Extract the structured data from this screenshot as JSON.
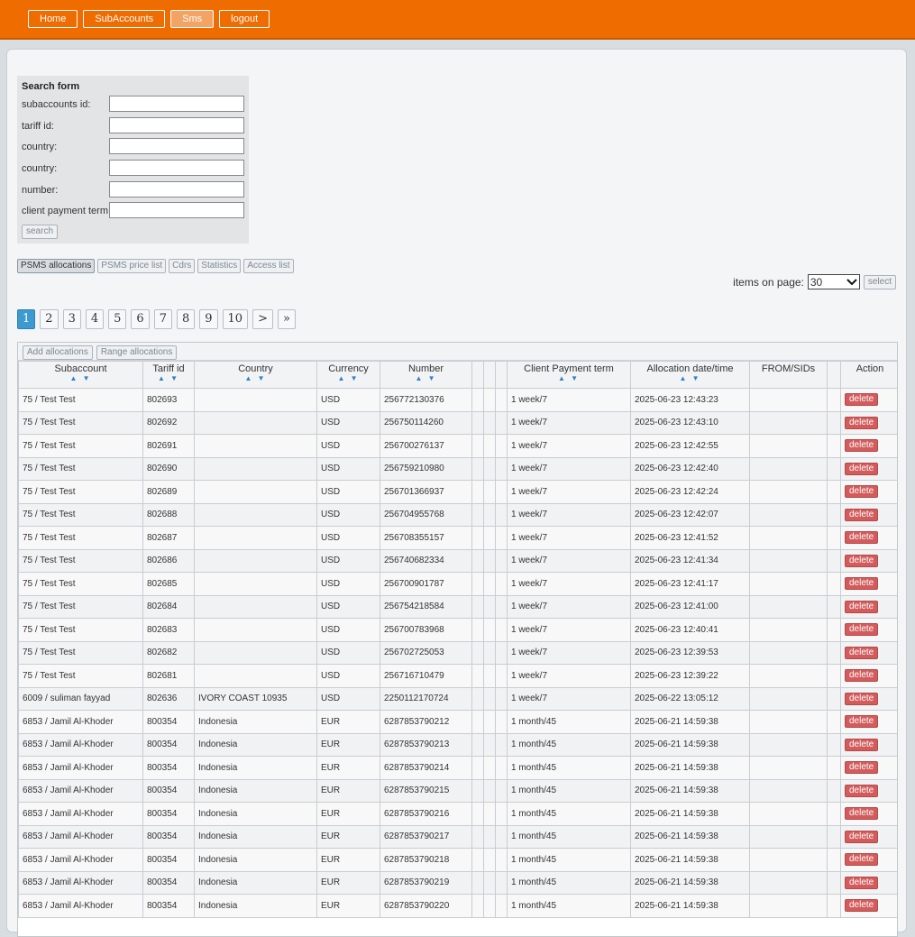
{
  "nav": {
    "items": [
      {
        "label": "Home"
      },
      {
        "label": "SubAccounts"
      },
      {
        "label": "Sms"
      },
      {
        "label": "logout"
      }
    ]
  },
  "search": {
    "title": "Search form",
    "fields": [
      {
        "label": "subaccounts id:",
        "value": ""
      },
      {
        "label": "tariff id:",
        "value": ""
      },
      {
        "label": "country:",
        "value": ""
      },
      {
        "label": "country:",
        "value": ""
      },
      {
        "label": "number:",
        "value": ""
      },
      {
        "label": "client payment term:",
        "value": ""
      }
    ],
    "button": "search"
  },
  "tabs": [
    "PSMS allocations",
    "PSMS price list",
    "Cdrs",
    "Statistics",
    "Access list"
  ],
  "items_per_page": {
    "label": "items on page:",
    "value": "30",
    "button": "select"
  },
  "pagination": [
    "1",
    "2",
    "3",
    "4",
    "5",
    "6",
    "7",
    "8",
    "9",
    "10",
    ">",
    "»"
  ],
  "table": {
    "tools": [
      "Add allocations",
      "Range allocations"
    ],
    "headers": [
      {
        "label": "Subaccount",
        "sortable": true
      },
      {
        "label": "Tariff id",
        "sortable": true
      },
      {
        "label": "Country",
        "sortable": true
      },
      {
        "label": "Currency",
        "sortable": true
      },
      {
        "label": "Number",
        "sortable": true
      },
      {
        "label": "",
        "sortable": false
      },
      {
        "label": "",
        "sortable": false
      },
      {
        "label": "",
        "sortable": false
      },
      {
        "label": "Client Payment term",
        "sortable": true
      },
      {
        "label": "Allocation date/time",
        "sortable": true
      },
      {
        "label": "FROM/SIDs",
        "sortable": false
      },
      {
        "label": "",
        "sortable": false
      },
      {
        "label": "Action",
        "sortable": false
      }
    ],
    "sort_glyph": "▲ ▼",
    "delete_label": "delete",
    "rows": [
      [
        "75 / Test Test",
        "802693",
        "",
        "USD",
        "256772130376",
        "1 week/7",
        "2025-06-23 12:43:23"
      ],
      [
        "75 / Test Test",
        "802692",
        "",
        "USD",
        "256750114260",
        "1 week/7",
        "2025-06-23 12:43:10"
      ],
      [
        "75 / Test Test",
        "802691",
        "",
        "USD",
        "256700276137",
        "1 week/7",
        "2025-06-23 12:42:55"
      ],
      [
        "75 / Test Test",
        "802690",
        "",
        "USD",
        "256759210980",
        "1 week/7",
        "2025-06-23 12:42:40"
      ],
      [
        "75 / Test Test",
        "802689",
        "",
        "USD",
        "256701366937",
        "1 week/7",
        "2025-06-23 12:42:24"
      ],
      [
        "75 / Test Test",
        "802688",
        "",
        "USD",
        "256704955768",
        "1 week/7",
        "2025-06-23 12:42:07"
      ],
      [
        "75 / Test Test",
        "802687",
        "",
        "USD",
        "256708355157",
        "1 week/7",
        "2025-06-23 12:41:52"
      ],
      [
        "75 / Test Test",
        "802686",
        "",
        "USD",
        "256740682334",
        "1 week/7",
        "2025-06-23 12:41:34"
      ],
      [
        "75 / Test Test",
        "802685",
        "",
        "USD",
        "256700901787",
        "1 week/7",
        "2025-06-23 12:41:17"
      ],
      [
        "75 / Test Test",
        "802684",
        "",
        "USD",
        "256754218584",
        "1 week/7",
        "2025-06-23 12:41:00"
      ],
      [
        "75 / Test Test",
        "802683",
        "",
        "USD",
        "256700783968",
        "1 week/7",
        "2025-06-23 12:40:41"
      ],
      [
        "75 / Test Test",
        "802682",
        "",
        "USD",
        "256702725053",
        "1 week/7",
        "2025-06-23 12:39:53"
      ],
      [
        "75 / Test Test",
        "802681",
        "",
        "USD",
        "256716710479",
        "1 week/7",
        "2025-06-23 12:39:22"
      ],
      [
        "6009 / suliman fayyad",
        "802636",
        "IVORY COAST 10935",
        "USD",
        "2250112170724",
        "1 week/7",
        "2025-06-22 13:05:12"
      ],
      [
        "6853 / Jamil Al-Khoder",
        "800354",
        "Indonesia",
        "EUR",
        "6287853790212",
        "1 month/45",
        "2025-06-21 14:59:38"
      ],
      [
        "6853 / Jamil Al-Khoder",
        "800354",
        "Indonesia",
        "EUR",
        "6287853790213",
        "1 month/45",
        "2025-06-21 14:59:38"
      ],
      [
        "6853 / Jamil Al-Khoder",
        "800354",
        "Indonesia",
        "EUR",
        "6287853790214",
        "1 month/45",
        "2025-06-21 14:59:38"
      ],
      [
        "6853 / Jamil Al-Khoder",
        "800354",
        "Indonesia",
        "EUR",
        "6287853790215",
        "1 month/45",
        "2025-06-21 14:59:38"
      ],
      [
        "6853 / Jamil Al-Khoder",
        "800354",
        "Indonesia",
        "EUR",
        "6287853790216",
        "1 month/45",
        "2025-06-21 14:59:38"
      ],
      [
        "6853 / Jamil Al-Khoder",
        "800354",
        "Indonesia",
        "EUR",
        "6287853790217",
        "1 month/45",
        "2025-06-21 14:59:38"
      ],
      [
        "6853 / Jamil Al-Khoder",
        "800354",
        "Indonesia",
        "EUR",
        "6287853790218",
        "1 month/45",
        "2025-06-21 14:59:38"
      ],
      [
        "6853 / Jamil Al-Khoder",
        "800354",
        "Indonesia",
        "EUR",
        "6287853790219",
        "1 month/45",
        "2025-06-21 14:59:38"
      ],
      [
        "6853 / Jamil Al-Khoder",
        "800354",
        "Indonesia",
        "EUR",
        "6287853790220",
        "1 month/45",
        "2025-06-21 14:59:38"
      ]
    ]
  }
}
